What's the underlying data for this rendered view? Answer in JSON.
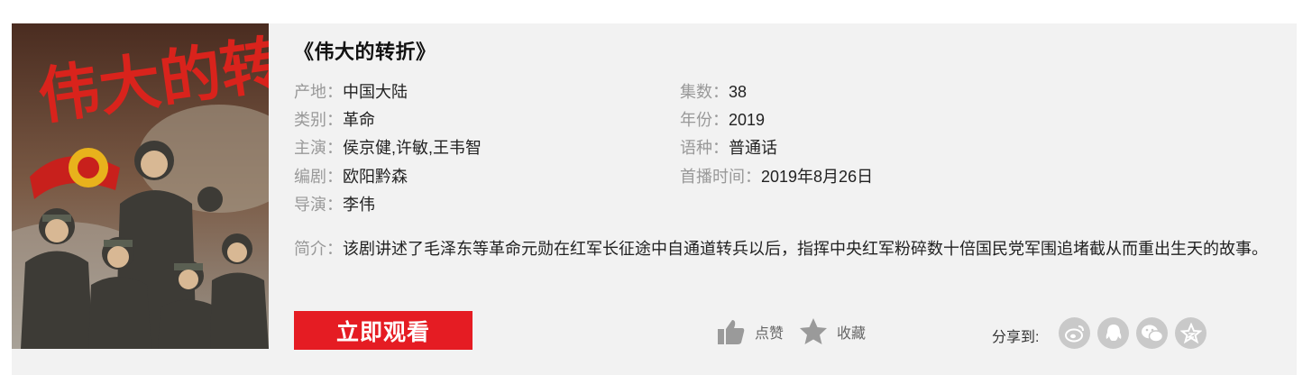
{
  "title": "《伟大的转折》",
  "poster": {
    "alt_title_text": "伟大的转折"
  },
  "info_left": [
    {
      "label": "产地：",
      "value": "中国大陆"
    },
    {
      "label": "类别：",
      "value": "革命"
    },
    {
      "label": "主演：",
      "value": "侯京健,许敏,王韦智"
    },
    {
      "label": "编剧：",
      "value": "欧阳黔森"
    },
    {
      "label": "导演：",
      "value": "李伟"
    }
  ],
  "info_right": [
    {
      "label": "集数：",
      "value": "38"
    },
    {
      "label": "年份：",
      "value": "2019"
    },
    {
      "label": "语种：",
      "value": "普通话"
    },
    {
      "label": "首播时间：",
      "value": "2019年8月26日"
    }
  ],
  "summary": {
    "label": "简介：",
    "text": "该剧讲述了毛泽东等革命元勋在红军长征途中自通道转兵以后，指挥中央红军粉碎数十倍国民党军围追堵截从而重出生天的故事。"
  },
  "actions": {
    "watch": "立即观看",
    "like": "点赞",
    "favorite": "收藏",
    "share_label": "分享到:"
  },
  "share_icons": [
    "weibo-icon",
    "qq-icon",
    "wechat-icon",
    "qzone-icon"
  ],
  "colors": {
    "accent": "#e51c23",
    "card_bg": "#f2f2f2",
    "label": "#999999",
    "icon_gray": "#c9c9c9"
  }
}
